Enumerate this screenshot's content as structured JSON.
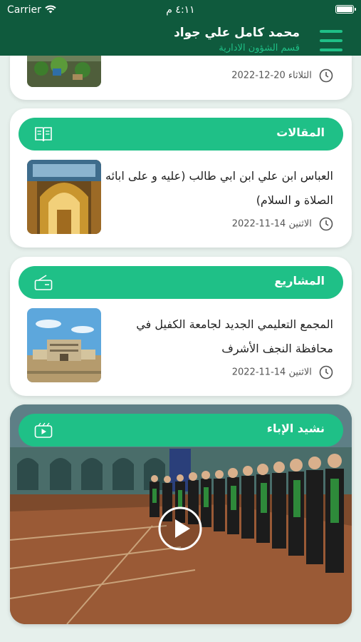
{
  "status_bar": {
    "carrier": "Carrier",
    "time": "٤:١١ م"
  },
  "header": {
    "user_name": "محمد كامل علي جواد",
    "department": "قسم الشؤون الادارية"
  },
  "cards": {
    "top_item": {
      "date": "الثلاثاء 20-12-2022"
    },
    "articles": {
      "section_title": "المقالات",
      "item_title": "العباس ابن علي ابن ابي طالب (عليه و على ابائه الصلاة و السلام)",
      "date": "الاثنين 14-11-2022"
    },
    "projects": {
      "section_title": "المشاريع",
      "item_title": "المجمع التعليمي الجديد لجامعة الكفيل في محافظة النجف الأشرف",
      "date": "الاثنين 14-11-2022"
    },
    "anthem": {
      "section_title": "نشيد الإباء"
    }
  },
  "colors": {
    "header_bg": "#0f5a3d",
    "accent": "#1fc087",
    "page_bg": "#e6f0ec"
  },
  "icons": [
    "wifi-icon",
    "battery-icon",
    "menu-icon",
    "clock-icon",
    "book-icon",
    "project-icon",
    "video-icon",
    "play-icon"
  ]
}
